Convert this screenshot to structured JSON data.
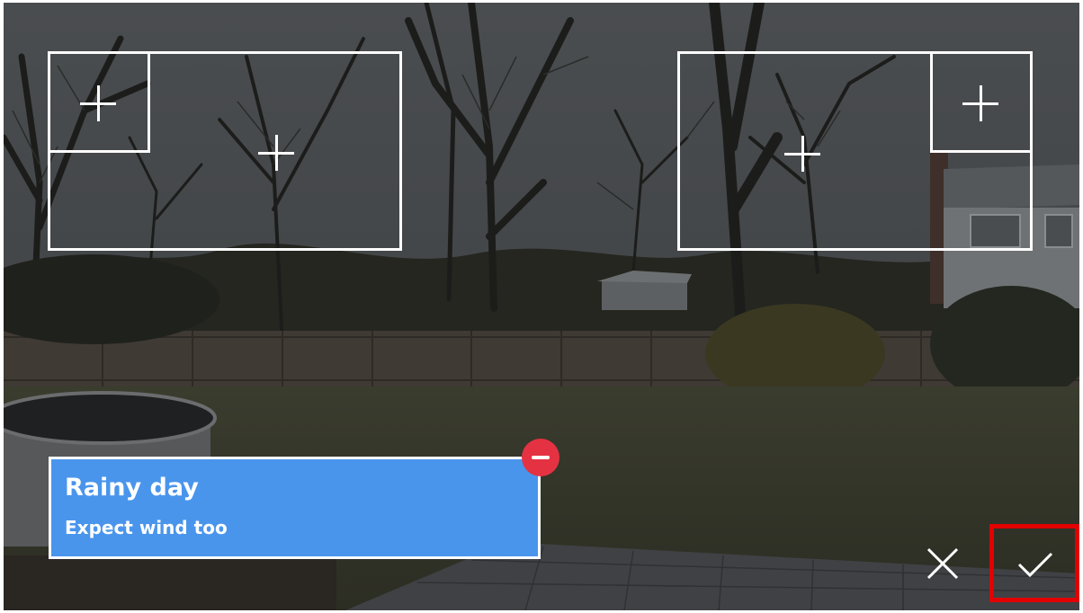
{
  "caption": {
    "title": "Rainy day",
    "subtitle": "Expect wind too"
  },
  "icons": {
    "remove": "minus-circle-icon",
    "cancel": "close-icon",
    "confirm": "checkmark-icon",
    "region_add": "plus-icon"
  },
  "colors": {
    "caption_background": "#4a95ec",
    "remove_badge": "#e53242",
    "confirm_highlight": "#e30000",
    "region_outline": "#ffffff"
  }
}
